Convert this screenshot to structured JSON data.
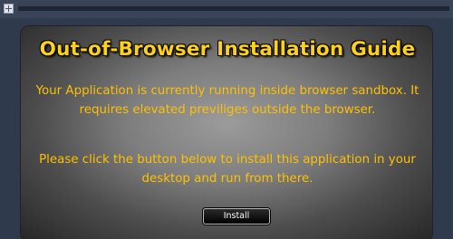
{
  "window": {
    "top_icon": "expand-icon"
  },
  "guide": {
    "title": "Out-of-Browser Installation Guide",
    "paragraph1": "Your Application is currently running inside browser sandbox. It requires elevated previliges outside the browser.",
    "paragraph2": "Please click the button below to install this application in your desktop and run from there.",
    "install_label": "Install"
  },
  "colors": {
    "title": "#ffd11a",
    "text": "#ffc000",
    "frame": "#2f3a4c"
  }
}
